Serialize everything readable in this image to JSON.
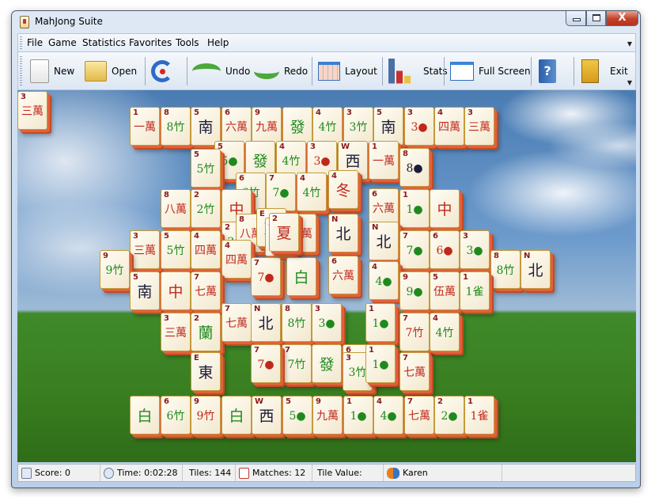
{
  "window": {
    "title": "MahJong Suite",
    "controls": [
      "minimize",
      "maximize",
      "close"
    ]
  },
  "menu": [
    {
      "label": "File",
      "accel": "F"
    },
    {
      "label": "Game",
      "accel": "G"
    },
    {
      "label": "Statistics",
      "accel": "S"
    },
    {
      "label": "Favorites",
      "accel": "a"
    },
    {
      "label": "Tools",
      "accel": "T"
    },
    {
      "label": "Help",
      "accel": "H"
    }
  ],
  "toolbar": {
    "new": "New",
    "open": "Open",
    "hint": "",
    "undo": "Undo",
    "redo": "Redo",
    "layout": "Layout",
    "stats": "Stats",
    "fullscreen": "Full Screen",
    "help": "",
    "exit": "Exit"
  },
  "tiles": [
    {
      "n": "1",
      "g": "一萬",
      "c": "red"
    },
    {
      "n": "8",
      "g": "8竹",
      "c": "grn"
    },
    {
      "n": "5",
      "g": "南",
      "c": "blk"
    },
    {
      "n": "6",
      "g": "六萬",
      "c": "red"
    },
    {
      "n": "9",
      "g": "九萬",
      "c": "red"
    },
    {
      "n": "",
      "g": "發",
      "c": "grn"
    },
    {
      "n": "4",
      "g": "4竹",
      "c": "grn"
    },
    {
      "n": "3",
      "g": "3竹",
      "c": "grn"
    },
    {
      "n": "5",
      "g": "南",
      "c": "blk"
    },
    {
      "n": "3",
      "g": "3●",
      "c": "red"
    },
    {
      "n": "4",
      "g": "四萬",
      "c": "red"
    },
    {
      "n": "3",
      "g": "三萬",
      "c": "red"
    },
    {
      "n": "5",
      "g": "5●",
      "c": "grn"
    },
    {
      "n": "",
      "g": "發",
      "c": "grn"
    },
    {
      "n": "4",
      "g": "4竹",
      "c": "grn"
    },
    {
      "n": "3",
      "g": "3●",
      "c": "red"
    },
    {
      "n": "W",
      "g": "西",
      "c": "blk"
    },
    {
      "n": "1",
      "g": "一萬",
      "c": "red"
    },
    {
      "n": "8",
      "g": "8●",
      "c": "blk"
    },
    {
      "n": "5",
      "g": "5竹",
      "c": "grn"
    },
    {
      "n": "6",
      "g": "6竹",
      "c": "grn"
    },
    {
      "n": "7",
      "g": "7●",
      "c": "grn"
    },
    {
      "n": "4",
      "g": "4竹",
      "c": "grn"
    },
    {
      "n": "4",
      "g": "冬",
      "c": "red"
    },
    {
      "n": "6",
      "g": "六萬",
      "c": "red"
    },
    {
      "n": "1",
      "g": "1●",
      "c": "grn"
    },
    {
      "n": "",
      "g": "中",
      "c": "red"
    },
    {
      "n": "8",
      "g": "八萬",
      "c": "red"
    },
    {
      "n": "2",
      "g": "2竹",
      "c": "grn"
    },
    {
      "n": "",
      "g": "中",
      "c": "red"
    },
    {
      "n": "2",
      "g": "2竹",
      "c": "grn"
    },
    {
      "n": "8",
      "g": "八萬",
      "c": "red"
    },
    {
      "n": "E",
      "g": "東",
      "c": "blk"
    },
    {
      "n": "4",
      "g": "四萬",
      "c": "red"
    },
    {
      "n": "3",
      "g": "三萬",
      "c": "red"
    },
    {
      "n": "N",
      "g": "北",
      "c": "blk"
    },
    {
      "n": "N",
      "g": "北",
      "c": "blk"
    },
    {
      "n": "3",
      "g": "三萬",
      "c": "red"
    },
    {
      "n": "5",
      "g": "5竹",
      "c": "grn"
    },
    {
      "n": "4",
      "g": "四萬",
      "c": "red"
    },
    {
      "n": "4",
      "g": "四萬",
      "c": "red"
    },
    {
      "n": "7",
      "g": "7●",
      "c": "red"
    },
    {
      "n": "",
      "g": "白",
      "c": "grn"
    },
    {
      "n": "6",
      "g": "六萬",
      "c": "red"
    },
    {
      "n": "4",
      "g": "4●",
      "c": "grn"
    },
    {
      "n": "7",
      "g": "7●",
      "c": "grn"
    },
    {
      "n": "6",
      "g": "6●",
      "c": "red"
    },
    {
      "n": "3",
      "g": "3●",
      "c": "grn"
    },
    {
      "n": "8",
      "g": "8竹",
      "c": "grn"
    },
    {
      "n": "N",
      "g": "北",
      "c": "blk"
    },
    {
      "n": "9",
      "g": "9竹",
      "c": "grn"
    },
    {
      "n": "5",
      "g": "南",
      "c": "blk"
    },
    {
      "n": "",
      "g": "中",
      "c": "red"
    },
    {
      "n": "7",
      "g": "七萬",
      "c": "red"
    },
    {
      "n": "9",
      "g": "9●",
      "c": "grn"
    },
    {
      "n": "5",
      "g": "伍萬",
      "c": "red"
    },
    {
      "n": "1",
      "g": "1雀",
      "c": "grn"
    },
    {
      "n": "3",
      "g": "三萬",
      "c": "red"
    },
    {
      "n": "2",
      "g": "蘭",
      "c": "grn"
    },
    {
      "n": "7",
      "g": "七萬",
      "c": "red"
    },
    {
      "n": "N",
      "g": "北",
      "c": "blk"
    },
    {
      "n": "8",
      "g": "8竹",
      "c": "grn"
    },
    {
      "n": "3",
      "g": "3●",
      "c": "grn"
    },
    {
      "n": "1",
      "g": "1●",
      "c": "grn"
    },
    {
      "n": "7",
      "g": "7竹",
      "c": "red"
    },
    {
      "n": "4",
      "g": "4竹",
      "c": "grn"
    },
    {
      "n": "E",
      "g": "東",
      "c": "blk"
    },
    {
      "n": "7",
      "g": "7竹",
      "c": "grn"
    },
    {
      "n": "7",
      "g": "7●",
      "c": "red"
    },
    {
      "n": "",
      "g": "發",
      "c": "grn"
    },
    {
      "n": "6",
      "g": "6●",
      "c": "red"
    },
    {
      "n": "3",
      "g": "3竹",
      "c": "grn"
    },
    {
      "n": "1",
      "g": "1●",
      "c": "grn"
    },
    {
      "n": "7",
      "g": "七萬",
      "c": "red"
    },
    {
      "n": "",
      "g": "白",
      "c": "grn"
    },
    {
      "n": "6",
      "g": "6竹",
      "c": "grn"
    },
    {
      "n": "9",
      "g": "9竹",
      "c": "red"
    },
    {
      "n": "",
      "g": "白",
      "c": "grn"
    },
    {
      "n": "W",
      "g": "西",
      "c": "blk"
    },
    {
      "n": "5",
      "g": "5●",
      "c": "grn"
    },
    {
      "n": "9",
      "g": "九萬",
      "c": "red"
    },
    {
      "n": "1",
      "g": "1●",
      "c": "grn"
    },
    {
      "n": "4",
      "g": "4●",
      "c": "grn"
    },
    {
      "n": "7",
      "g": "七萬",
      "c": "red"
    },
    {
      "n": "2",
      "g": "2●",
      "c": "grn"
    },
    {
      "n": "1",
      "g": "1雀",
      "c": "red"
    },
    {
      "n": "2",
      "g": "夏",
      "c": "red"
    },
    {
      "n": "3",
      "g": "三萬",
      "c": "red"
    }
  ],
  "status": {
    "score": "Score: 0",
    "time": "Time: 0:02:28",
    "tiles": "Tiles: 144",
    "matches": "Matches: 12",
    "tile_value": "Tile Value:",
    "player": "Karen"
  }
}
